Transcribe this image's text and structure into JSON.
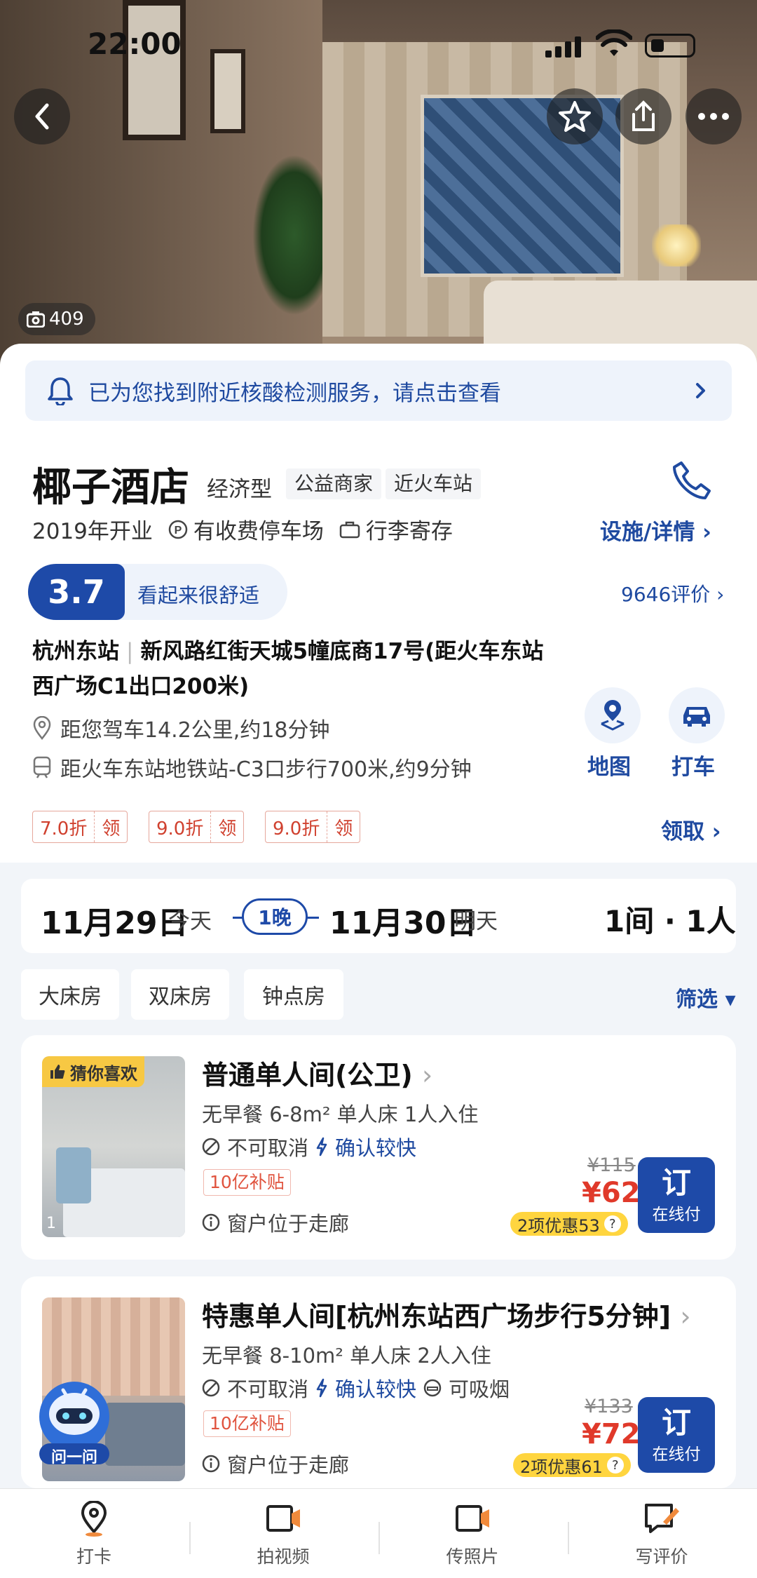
{
  "status_bar": {
    "time": "22:00"
  },
  "hero": {
    "photo_count": "409"
  },
  "notice": {
    "text": "已为您找到附近核酸检测服务，请点击查看"
  },
  "hotel": {
    "name": "椰子酒店",
    "type_tag": "经济型",
    "tags": [
      "公益商家",
      "近火车站"
    ],
    "opened": "2019年开业",
    "parking": "有收费停车场",
    "luggage": "行李寄存",
    "detail_link": "设施/详情",
    "score": "3.7",
    "score_text": "看起来很舒适",
    "reviews_link": "9646评价",
    "area": "杭州东站",
    "address": "新风路红街天城5幢底商17号(距火车东站西广场C1出口200米)",
    "drive_distance": "距您驾车14.2公里,约18分钟",
    "metro_distance": "距火车东站地铁站-C3口步行700米,约9分钟",
    "map_label": "地图",
    "taxi_label": "打车"
  },
  "coupons": [
    {
      "discount": "7.0折",
      "action": "领"
    },
    {
      "discount": "9.0折",
      "action": "领"
    },
    {
      "discount": "9.0折",
      "action": "领"
    }
  ],
  "coupon_claim": "领取",
  "dates": {
    "checkin": "11月29日",
    "checkin_sub": "今天",
    "nights": "1晚",
    "checkout": "11月30日",
    "checkout_sub": "明天",
    "guests": "1间 · 1人"
  },
  "filters": {
    "chips": [
      "大床房",
      "双床房",
      "钟点房"
    ],
    "filter_link": "筛选"
  },
  "rooms": [
    {
      "badge": "猜你喜欢",
      "img_count": "1",
      "title": "普通单人间(公卫)",
      "spec": "无早餐  6-8m²  单人床  1人入住",
      "cancel": "不可取消",
      "confirm": "确认较快",
      "smoke": "",
      "subsidy": "10亿补贴",
      "window": "窗户位于走廊",
      "old_price": "¥115",
      "price": "¥62",
      "promo": "2项优惠53",
      "book": "订",
      "pay": "在线付"
    },
    {
      "badge": "",
      "img_count": "",
      "title": "特惠单人间[杭州东站西广场步行5分钟]",
      "spec": "无早餐  8-10m²  单人床  2人入住",
      "cancel": "不可取消",
      "confirm": "确认较快",
      "smoke": "可吸烟",
      "subsidy": "10亿补贴",
      "window": "窗户位于走廊",
      "old_price": "¥133",
      "price": "¥72",
      "promo": "2项优惠61",
      "book": "订",
      "pay": "在线付"
    }
  ],
  "assistant_label": "问一问",
  "tabbar": {
    "items": [
      "打卡",
      "拍视频",
      "传照片",
      "写评价"
    ]
  },
  "colors": {
    "brand_blue": "#1e4aa8",
    "price_red": "#e0392a",
    "promo_yellow": "#ffd53f"
  }
}
